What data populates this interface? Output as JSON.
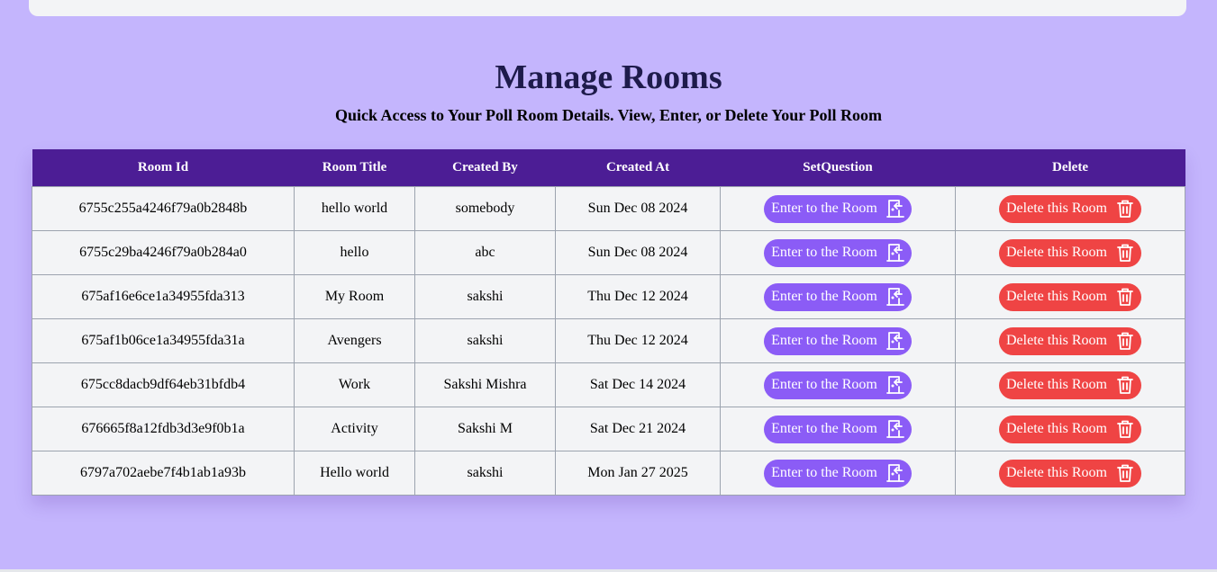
{
  "page": {
    "title": "Manage Rooms",
    "subtitle": "Quick Access to Your Poll Room Details. View, Enter, or Delete Your Poll Room"
  },
  "table": {
    "headers": [
      "Room Id",
      "Room Title",
      "Created By",
      "Created At",
      "SetQuestion",
      "Delete"
    ],
    "enter_label": "Enter to the Room",
    "delete_label": "Delete this Room",
    "rows": [
      {
        "id": "6755c255a4246f79a0b2848b",
        "title": "hello world",
        "created_by": "somebody",
        "created_at": "Sun Dec 08 2024"
      },
      {
        "id": "6755c29ba4246f79a0b284a0",
        "title": "hello",
        "created_by": "abc",
        "created_at": "Sun Dec 08 2024"
      },
      {
        "id": "675af16e6ce1a34955fda313",
        "title": "My Room",
        "created_by": "sakshi",
        "created_at": "Thu Dec 12 2024"
      },
      {
        "id": "675af1b06ce1a34955fda31a",
        "title": "Avengers",
        "created_by": "sakshi",
        "created_at": "Thu Dec 12 2024"
      },
      {
        "id": "675cc8dacb9df64eb31bfdb4",
        "title": "Work",
        "created_by": "Sakshi Mishra",
        "created_at": "Sat Dec 14 2024"
      },
      {
        "id": "676665f8a12fdb3d3e9f0b1a",
        "title": "Activity",
        "created_by": "Sakshi M",
        "created_at": "Sat Dec 21 2024"
      },
      {
        "id": "6797a702aebe7f4b1ab1a93b",
        "title": "Hello world",
        "created_by": "sakshi",
        "created_at": "Mon Jan 27 2025"
      }
    ]
  },
  "icons": {
    "enter": "door-enter-icon",
    "delete": "trash-icon"
  },
  "colors": {
    "background": "#c4b5fd",
    "header": "#4c1d95",
    "enter_button": "#8b5cf6",
    "delete_button": "#ef4444"
  }
}
